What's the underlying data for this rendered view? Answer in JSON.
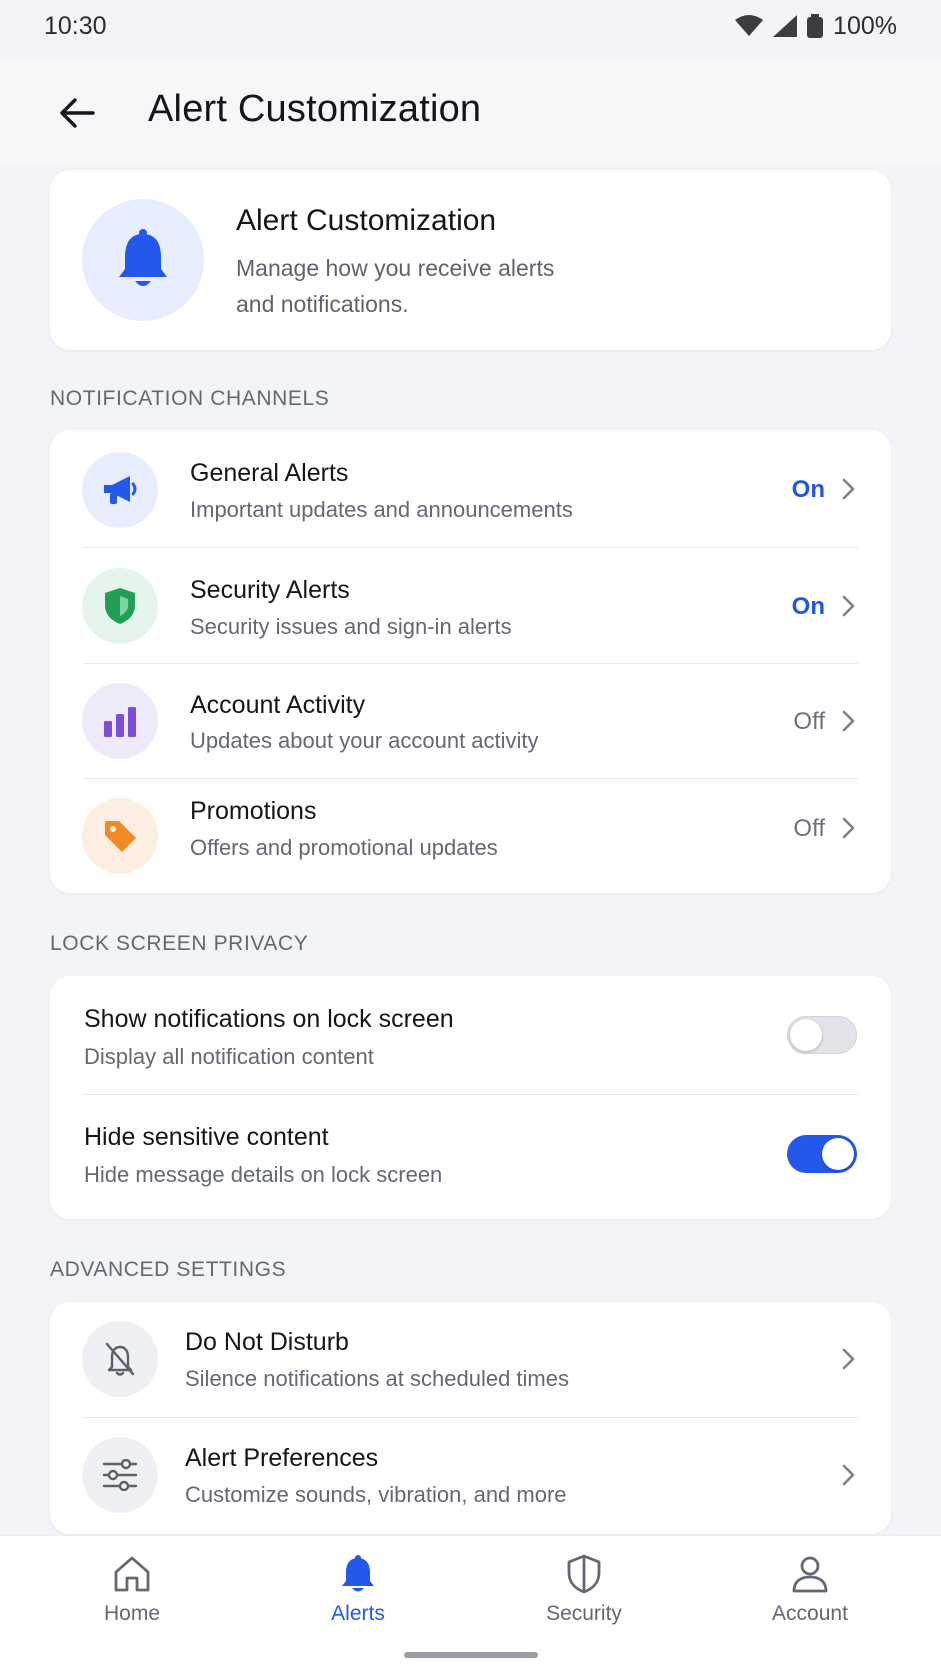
{
  "status_bar": {
    "time": "10:30",
    "battery": "100%"
  },
  "app_bar": {
    "title": "Alert Customization",
    "back_icon": "arrow-left-icon"
  },
  "hero": {
    "icon": "bell-icon",
    "title": "Alert Customization",
    "description": "Manage how you receive alerts and notifications."
  },
  "sections": {
    "channels": "NOTIFICATION CHANNELS",
    "lock": "LOCK SCREEN PRIVACY",
    "advanced": "ADVANCED SETTINGS"
  },
  "channels": [
    {
      "title": "General Alerts",
      "subtitle": "Important updates and announcements",
      "value": "On",
      "icon": "megaphone-icon",
      "color": "#2458ea",
      "bg": "#e8edfd"
    },
    {
      "title": "Security Alerts",
      "subtitle": "Security issues and sign-in alerts",
      "value": "On",
      "icon": "shield-icon",
      "color": "#1fa055",
      "bg": "#e6f5ec"
    },
    {
      "title": "Account Activity",
      "subtitle": "Updates about your account activity",
      "value": "Off",
      "icon": "bar-chart-icon",
      "color": "#7b4fd6",
      "bg": "#efeafa"
    },
    {
      "title": "Promotions",
      "subtitle": "Offers and promotional updates",
      "value": "Off",
      "icon": "tag-icon",
      "color": "#f08a24",
      "bg": "#fdeee2"
    }
  ],
  "lock_screen": [
    {
      "title": "Show notifications on lock screen",
      "subtitle": "Display all notification content",
      "enabled": false
    },
    {
      "title": "Hide sensitive content",
      "subtitle": "Hide message details on lock screen",
      "enabled": true
    }
  ],
  "advanced": [
    {
      "title": "Do Not Disturb",
      "subtitle": "Silence notifications at scheduled times",
      "icon": "bell-off-icon"
    },
    {
      "title": "Alert Preferences",
      "subtitle": "Customize sounds, vibration, and more",
      "icon": "sliders-icon"
    }
  ],
  "bottom_nav": [
    {
      "label": "Home",
      "icon": "home-icon",
      "active": false
    },
    {
      "label": "Alerts",
      "icon": "bell-icon",
      "active": true
    },
    {
      "label": "Security",
      "icon": "shield-icon",
      "active": false
    },
    {
      "label": "Account",
      "icon": "user-icon",
      "active": false
    }
  ],
  "colors": {
    "accent": "#2458ea",
    "background": "#f3f4f7",
    "card": "#ffffff"
  }
}
